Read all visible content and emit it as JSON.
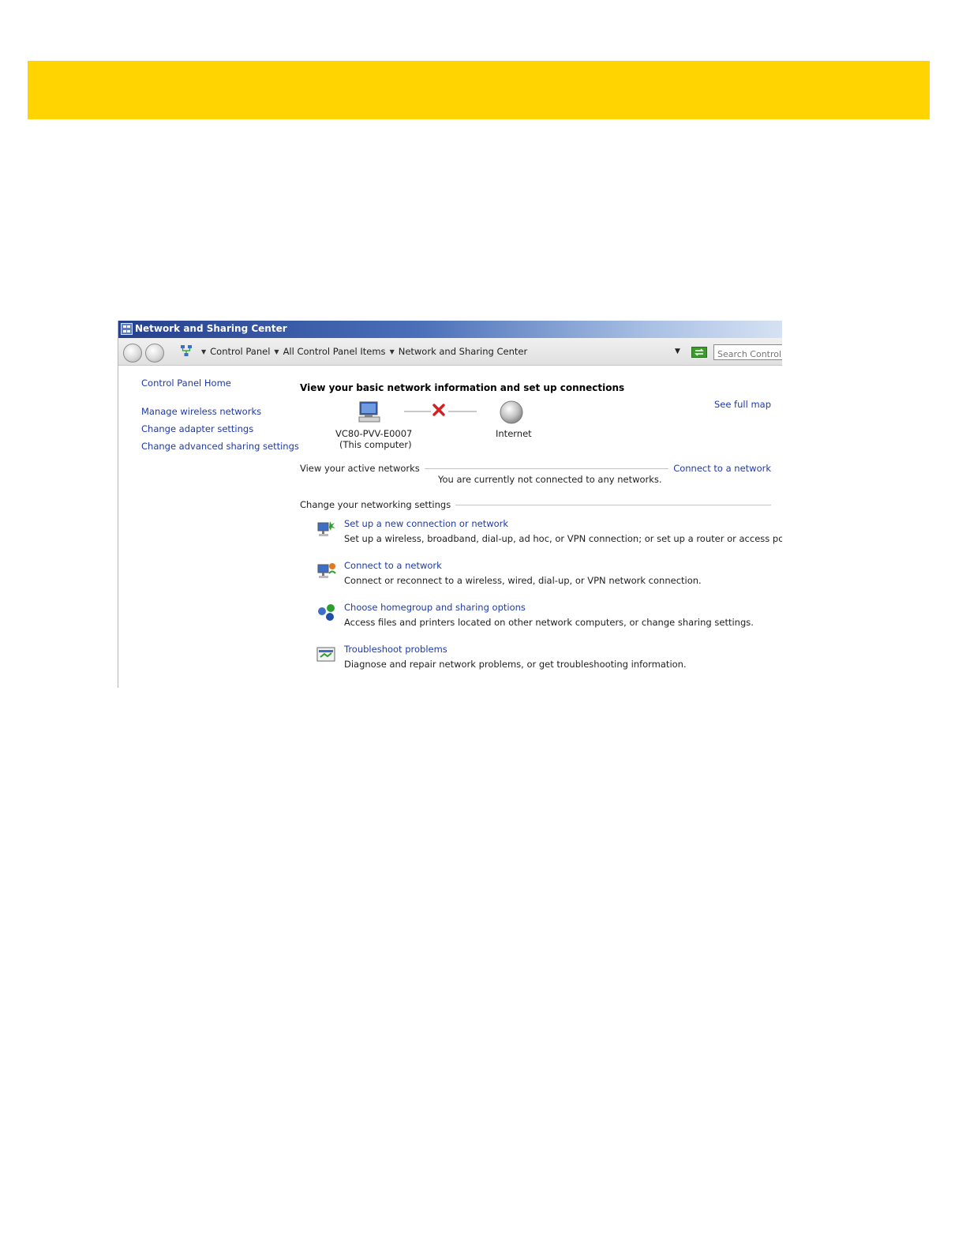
{
  "colors": {
    "banner": "#ffd400",
    "link": "#1f3aa8",
    "title_bar": "#26408e"
  },
  "window": {
    "title": "Network and Sharing Center",
    "breadcrumb": [
      "Control Panel",
      "All Control Panel Items",
      "Network and Sharing Center"
    ],
    "search_placeholder": "Search Control P"
  },
  "sidebar": {
    "home": "Control Panel Home",
    "items": [
      {
        "label": "Manage wireless networks"
      },
      {
        "label": "Change adapter settings"
      },
      {
        "label": "Change advanced sharing settings"
      }
    ]
  },
  "main": {
    "heading": "View your basic network information and set up connections",
    "see_full_map": "See full map",
    "computer_name": "VC80-PVV-E0007",
    "computer_sub": "(This computer)",
    "internet_label": "Internet",
    "active_networks": {
      "title": "View your active networks",
      "connect_link": "Connect to a network",
      "status": "You are currently not connected to any networks."
    },
    "settings_title": "Change your networking settings",
    "tasks": [
      {
        "icon": "new-connection-icon",
        "link": "Set up a new connection or network",
        "desc": "Set up a wireless, broadband, dial-up, ad hoc, or VPN connection; or set up a router or access point."
      },
      {
        "icon": "connect-network-icon",
        "link": "Connect to a network",
        "desc": "Connect or reconnect to a wireless, wired, dial-up, or VPN network connection."
      },
      {
        "icon": "homegroup-icon",
        "link": "Choose homegroup and sharing options",
        "desc": "Access files and printers located on other network computers, or change sharing settings."
      },
      {
        "icon": "troubleshoot-icon",
        "link": "Troubleshoot problems",
        "desc": "Diagnose and repair network problems, or get troubleshooting information."
      }
    ]
  }
}
